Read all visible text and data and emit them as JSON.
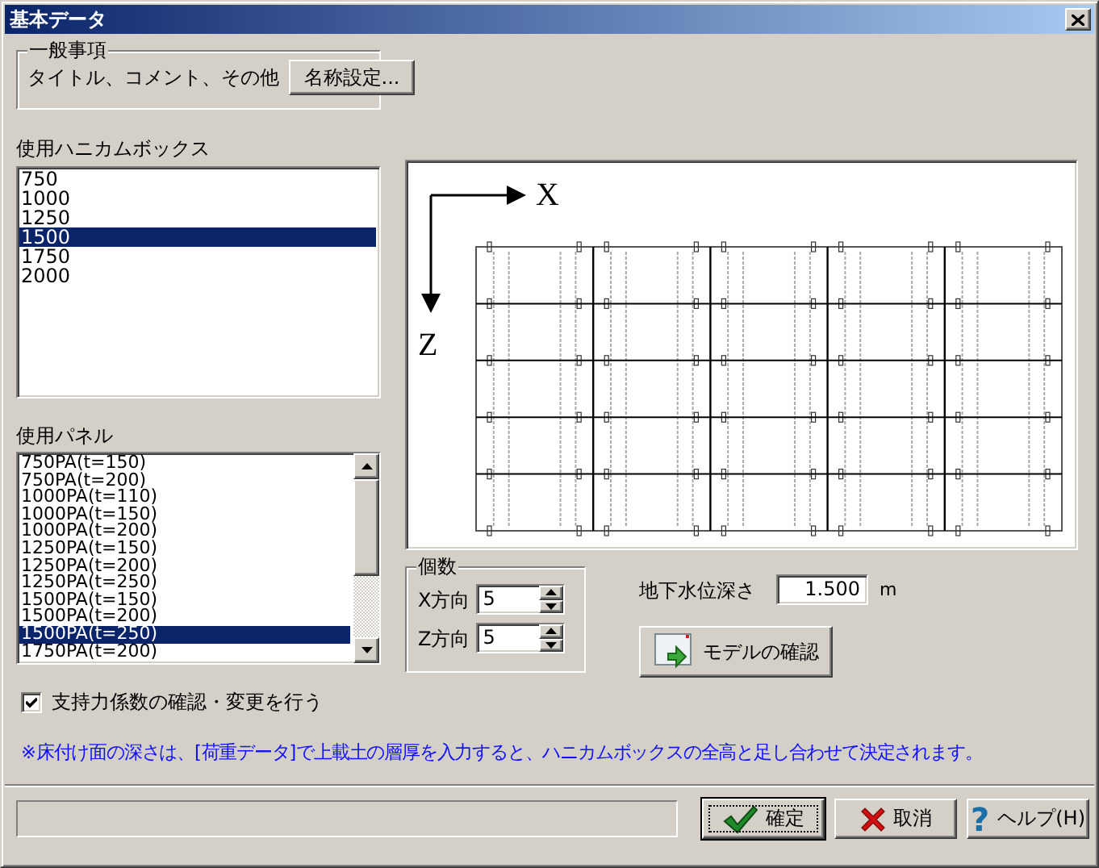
{
  "window": {
    "title": "基本データ"
  },
  "general": {
    "legend": "一般事項",
    "text": "タイトル、コメント、その他",
    "button": "名称設定..."
  },
  "honeycomb_box": {
    "label": "使用ハニカムボックス",
    "items": [
      {
        "label": "750",
        "selected": false
      },
      {
        "label": "1000",
        "selected": false
      },
      {
        "label": "1250",
        "selected": false
      },
      {
        "label": "1500",
        "selected": true
      },
      {
        "label": "1750",
        "selected": false
      },
      {
        "label": "2000",
        "selected": false
      }
    ]
  },
  "panel": {
    "label": "使用パネル",
    "items": [
      {
        "label": "750PA(t=150)",
        "selected": false
      },
      {
        "label": "750PA(t=200)",
        "selected": false
      },
      {
        "label": "1000PA(t=110)",
        "selected": false
      },
      {
        "label": "1000PA(t=150)",
        "selected": false
      },
      {
        "label": "1000PA(t=200)",
        "selected": false
      },
      {
        "label": "1250PA(t=150)",
        "selected": false
      },
      {
        "label": "1250PA(t=200)",
        "selected": false
      },
      {
        "label": "1250PA(t=250)",
        "selected": false
      },
      {
        "label": "1500PA(t=150)",
        "selected": false
      },
      {
        "label": "1500PA(t=200)",
        "selected": false
      },
      {
        "label": "1500PA(t=250)",
        "selected": true
      },
      {
        "label": "1750PA(t=200)",
        "selected": false
      }
    ]
  },
  "preview": {
    "x_axis": "X",
    "z_axis": "Z"
  },
  "count": {
    "legend": "個数",
    "fields": [
      {
        "label": "X方向",
        "value": "5"
      },
      {
        "label": "Z方向",
        "value": "5"
      }
    ]
  },
  "groundwater": {
    "label": "地下水位深さ",
    "value": "1.500",
    "unit": "m"
  },
  "model_button": {
    "label": "モデルの確認"
  },
  "check": {
    "label": "支持力係数の確認・変更を行う",
    "checked": true
  },
  "note": "※床付け面の深さは、[荷重データ]で上載土の層厚を入力すると、ハニカムボックスの全高と足し合わせて決定されます。",
  "buttons": [
    {
      "kind": "ok",
      "label": "確定",
      "focused": true
    },
    {
      "kind": "cancel",
      "label": "取消",
      "focused": false
    },
    {
      "kind": "help",
      "label": "ヘルプ(H)",
      "icon": "?",
      "focused": false
    }
  ]
}
